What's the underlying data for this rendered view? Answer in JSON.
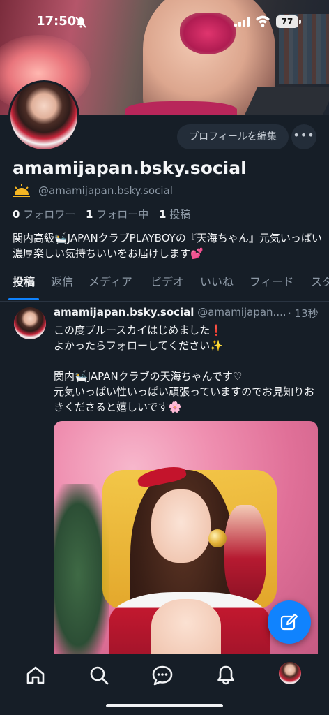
{
  "status_bar": {
    "time": "17:50",
    "battery": "77",
    "icons": [
      "bell-off-icon",
      "signal-icon",
      "wifi-icon",
      "battery-icon"
    ]
  },
  "profile": {
    "edit_label": "プロフィールを編集",
    "more_label": "•••",
    "display_name": "amamijapan.bsky.social",
    "handle": "@amamijapan.bsky.social",
    "followers_count": "0",
    "followers_label": "フォロワー",
    "following_count": "1",
    "following_label": "フォロー中",
    "posts_count": "1",
    "posts_label": "投稿",
    "bio": "関内高級🛀JAPANクラブPLAYBOYの『天海ちゃん』元気いっぱい濃厚楽しい気持ちいいをお届けします💕"
  },
  "tabs": [
    "投稿",
    "返信",
    "メディア",
    "ビデオ",
    "いいね",
    "フィード",
    "スタ"
  ],
  "active_tab": 0,
  "post": {
    "author_name": "amamijapan.bsky.social",
    "author_handle": "@amamijapan....",
    "time": "· 13秒",
    "text": "この度ブルースカイはじめました❗\nよかったらフォローしてください✨\n\n関内🛀JAPANクラブの天海ちゃんです♡\n元気いっぱい性いっぱい頑張っていますのでお見知りおきくださると嬉しいです🌸"
  },
  "bottom_nav": [
    "home-icon",
    "search-icon",
    "chat-icon",
    "bell-icon",
    "profile-avatar"
  ],
  "colors": {
    "background": "#161e27",
    "accent": "#1083fe",
    "muted_text": "#8d99a6",
    "button_bg": "#232d39"
  }
}
